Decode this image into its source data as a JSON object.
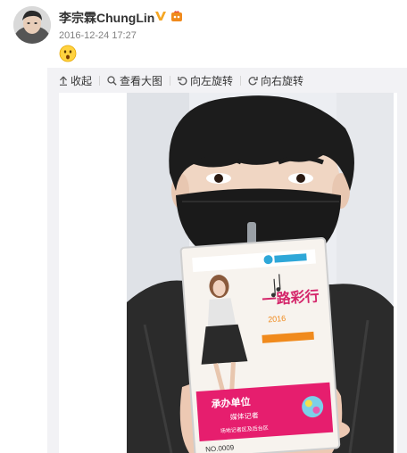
{
  "post": {
    "username": "李宗霖ChungLin",
    "timestamp": "2016-12-24 17:27",
    "content_emoji": "surprised-face-emoji"
  },
  "toolbar": {
    "collapse_label": "收起",
    "view_large_label": "查看大图",
    "rotate_left_label": "向左旋转",
    "rotate_right_label": "向右旋转"
  },
  "photo": {
    "badge_title": "一路彩行",
    "badge_subtitle": "2016",
    "badge_section": "承办单位",
    "badge_role": "媒体记者",
    "badge_area": "场地记者区及后台区",
    "badge_number": "NO.0009"
  },
  "colors": {
    "verified_gold": "#f5a623",
    "pass_pink": "#e61e6e",
    "accent_orange": "#f08a1d"
  }
}
